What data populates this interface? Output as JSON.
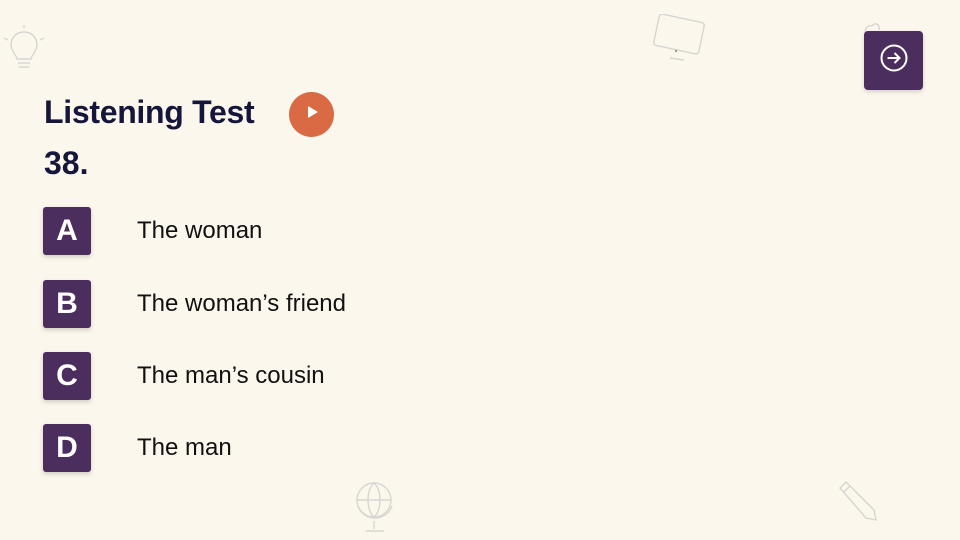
{
  "header": {
    "title": "Listening Test",
    "question_number": "38."
  },
  "controls": {
    "play_icon": "play-icon",
    "next_icon": "arrow-right-circle-icon"
  },
  "options": [
    {
      "letter": "A",
      "text": "The woman"
    },
    {
      "letter": "B",
      "text": "The woman’s friend"
    },
    {
      "letter": "C",
      "text": "The man’s cousin"
    },
    {
      "letter": "D",
      "text": "The man"
    }
  ],
  "colors": {
    "background": "#fbf7ed",
    "accent_purple": "#4b2e5e",
    "play_orange": "#d96a44",
    "title": "#16163a"
  },
  "decorations": [
    "lightbulb-icon",
    "monitor-icon",
    "globe-icon",
    "pencil-icon",
    "heart-icon"
  ]
}
